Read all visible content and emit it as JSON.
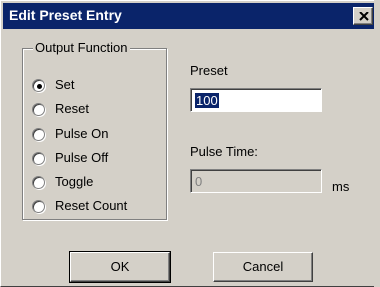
{
  "window": {
    "title": "Edit Preset Entry",
    "close_icon": "close-icon"
  },
  "output_function": {
    "legend": "Output Function",
    "selected": "Set",
    "options": [
      "Set",
      "Reset",
      "Pulse On",
      "Pulse Off",
      "Toggle",
      "Reset Count"
    ]
  },
  "preset": {
    "label": "Preset",
    "value": "100"
  },
  "pulse_time": {
    "label": "Pulse Time:",
    "value": "0",
    "unit": "ms",
    "disabled": true
  },
  "buttons": {
    "ok_label": "OK",
    "cancel_label": "Cancel"
  },
  "colors": {
    "titlebar": "#0a246a",
    "face": "#d4d0c8"
  }
}
